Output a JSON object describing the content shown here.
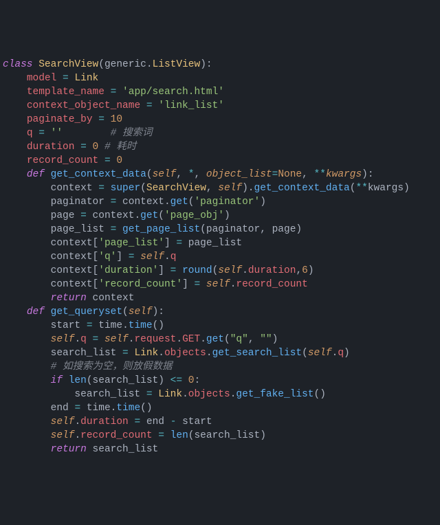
{
  "code": {
    "lines": [
      {
        "indent": 0,
        "tokens": [
          {
            "t": "class ",
            "c": "kw"
          },
          {
            "t": "SearchView",
            "c": "cls"
          },
          {
            "t": "(",
            "c": "pun"
          },
          {
            "t": "generic",
            "c": "plain"
          },
          {
            "t": ".",
            "c": "pun"
          },
          {
            "t": "ListView",
            "c": "cls"
          },
          {
            "t": "):",
            "c": "pun"
          }
        ]
      },
      {
        "indent": 1,
        "tokens": [
          {
            "t": "model ",
            "c": "attr"
          },
          {
            "t": "= ",
            "c": "op"
          },
          {
            "t": "Link",
            "c": "cls"
          }
        ]
      },
      {
        "indent": 1,
        "tokens": [
          {
            "t": "template_name ",
            "c": "attr"
          },
          {
            "t": "= ",
            "c": "op"
          },
          {
            "t": "'app/search.html'",
            "c": "str"
          }
        ]
      },
      {
        "indent": 1,
        "tokens": [
          {
            "t": "context_object_name ",
            "c": "attr"
          },
          {
            "t": "= ",
            "c": "op"
          },
          {
            "t": "'link_list'",
            "c": "str"
          }
        ]
      },
      {
        "indent": 1,
        "tokens": [
          {
            "t": "paginate_by ",
            "c": "attr"
          },
          {
            "t": "= ",
            "c": "op"
          },
          {
            "t": "10",
            "c": "num"
          }
        ]
      },
      {
        "indent": 1,
        "tokens": [
          {
            "t": "q ",
            "c": "attr"
          },
          {
            "t": "= ",
            "c": "op"
          },
          {
            "t": "''",
            "c": "str"
          },
          {
            "t": "        ",
            "c": "plain"
          },
          {
            "t": "# 搜索词",
            "c": "cmt"
          }
        ]
      },
      {
        "indent": 1,
        "tokens": [
          {
            "t": "duration ",
            "c": "attr"
          },
          {
            "t": "= ",
            "c": "op"
          },
          {
            "t": "0 ",
            "c": "num"
          },
          {
            "t": "# 耗时",
            "c": "cmt"
          }
        ]
      },
      {
        "indent": 1,
        "tokens": [
          {
            "t": "record_count ",
            "c": "attr"
          },
          {
            "t": "= ",
            "c": "op"
          },
          {
            "t": "0",
            "c": "num"
          }
        ]
      },
      {
        "indent": 1,
        "tokens": [
          {
            "t": "def ",
            "c": "kw"
          },
          {
            "t": "get_context_data",
            "c": "fn"
          },
          {
            "t": "(",
            "c": "pun"
          },
          {
            "t": "self",
            "c": "param"
          },
          {
            "t": ", ",
            "c": "pun"
          },
          {
            "t": "*",
            "c": "op"
          },
          {
            "t": ", ",
            "c": "pun"
          },
          {
            "t": "object_list",
            "c": "param"
          },
          {
            "t": "=",
            "c": "op"
          },
          {
            "t": "None",
            "c": "none"
          },
          {
            "t": ", ",
            "c": "pun"
          },
          {
            "t": "**",
            "c": "op"
          },
          {
            "t": "kwargs",
            "c": "param"
          },
          {
            "t": "):",
            "c": "pun"
          }
        ]
      },
      {
        "indent": 2,
        "tokens": [
          {
            "t": "context ",
            "c": "plain"
          },
          {
            "t": "= ",
            "c": "op"
          },
          {
            "t": "super",
            "c": "fn"
          },
          {
            "t": "(",
            "c": "pun"
          },
          {
            "t": "SearchView",
            "c": "cls"
          },
          {
            "t": ", ",
            "c": "pun"
          },
          {
            "t": "self",
            "c": "param"
          },
          {
            "t": ").",
            "c": "pun"
          },
          {
            "t": "get_context_data",
            "c": "fn"
          },
          {
            "t": "(",
            "c": "pun"
          },
          {
            "t": "**",
            "c": "op"
          },
          {
            "t": "kwargs",
            "c": "plain"
          },
          {
            "t": ")",
            "c": "pun"
          }
        ]
      },
      {
        "indent": 2,
        "tokens": [
          {
            "t": "paginator ",
            "c": "plain"
          },
          {
            "t": "= ",
            "c": "op"
          },
          {
            "t": "context",
            "c": "plain"
          },
          {
            "t": ".",
            "c": "pun"
          },
          {
            "t": "get",
            "c": "fn"
          },
          {
            "t": "(",
            "c": "pun"
          },
          {
            "t": "'paginator'",
            "c": "str"
          },
          {
            "t": ")",
            "c": "pun"
          }
        ]
      },
      {
        "indent": 2,
        "tokens": [
          {
            "t": "page ",
            "c": "plain"
          },
          {
            "t": "= ",
            "c": "op"
          },
          {
            "t": "context",
            "c": "plain"
          },
          {
            "t": ".",
            "c": "pun"
          },
          {
            "t": "get",
            "c": "fn"
          },
          {
            "t": "(",
            "c": "pun"
          },
          {
            "t": "'page_obj'",
            "c": "str"
          },
          {
            "t": ")",
            "c": "pun"
          }
        ]
      },
      {
        "indent": 2,
        "tokens": [
          {
            "t": "page_list ",
            "c": "plain"
          },
          {
            "t": "= ",
            "c": "op"
          },
          {
            "t": "get_page_list",
            "c": "fn"
          },
          {
            "t": "(",
            "c": "pun"
          },
          {
            "t": "paginator",
            "c": "plain"
          },
          {
            "t": ", ",
            "c": "pun"
          },
          {
            "t": "page",
            "c": "plain"
          },
          {
            "t": ")",
            "c": "pun"
          }
        ]
      },
      {
        "indent": 2,
        "tokens": [
          {
            "t": "context",
            "c": "plain"
          },
          {
            "t": "[",
            "c": "pun"
          },
          {
            "t": "'page_list'",
            "c": "str"
          },
          {
            "t": "] ",
            "c": "pun"
          },
          {
            "t": "= ",
            "c": "op"
          },
          {
            "t": "page_list",
            "c": "plain"
          }
        ]
      },
      {
        "indent": 2,
        "tokens": [
          {
            "t": "context",
            "c": "plain"
          },
          {
            "t": "[",
            "c": "pun"
          },
          {
            "t": "'q'",
            "c": "str"
          },
          {
            "t": "] ",
            "c": "pun"
          },
          {
            "t": "= ",
            "c": "op"
          },
          {
            "t": "self",
            "c": "param"
          },
          {
            "t": ".",
            "c": "pun"
          },
          {
            "t": "q",
            "c": "attr"
          }
        ]
      },
      {
        "indent": 2,
        "tokens": [
          {
            "t": "context",
            "c": "plain"
          },
          {
            "t": "[",
            "c": "pun"
          },
          {
            "t": "'duration'",
            "c": "str"
          },
          {
            "t": "] ",
            "c": "pun"
          },
          {
            "t": "= ",
            "c": "op"
          },
          {
            "t": "round",
            "c": "fn"
          },
          {
            "t": "(",
            "c": "pun"
          },
          {
            "t": "self",
            "c": "param"
          },
          {
            "t": ".",
            "c": "pun"
          },
          {
            "t": "duration",
            "c": "attr"
          },
          {
            "t": ",",
            "c": "pun"
          },
          {
            "t": "6",
            "c": "num"
          },
          {
            "t": ")",
            "c": "pun"
          }
        ]
      },
      {
        "indent": 2,
        "tokens": [
          {
            "t": "context",
            "c": "plain"
          },
          {
            "t": "[",
            "c": "pun"
          },
          {
            "t": "'record_count'",
            "c": "str"
          },
          {
            "t": "] ",
            "c": "pun"
          },
          {
            "t": "= ",
            "c": "op"
          },
          {
            "t": "self",
            "c": "param"
          },
          {
            "t": ".",
            "c": "pun"
          },
          {
            "t": "record_count",
            "c": "attr"
          }
        ]
      },
      {
        "indent": 2,
        "tokens": [
          {
            "t": "return ",
            "c": "kw"
          },
          {
            "t": "context",
            "c": "plain"
          }
        ]
      },
      {
        "indent": 1,
        "tokens": [
          {
            "t": "def ",
            "c": "kw"
          },
          {
            "t": "get_queryset",
            "c": "fn"
          },
          {
            "t": "(",
            "c": "pun"
          },
          {
            "t": "self",
            "c": "param"
          },
          {
            "t": "):",
            "c": "pun"
          }
        ]
      },
      {
        "indent": 2,
        "tokens": [
          {
            "t": "start ",
            "c": "plain"
          },
          {
            "t": "= ",
            "c": "op"
          },
          {
            "t": "time",
            "c": "plain"
          },
          {
            "t": ".",
            "c": "pun"
          },
          {
            "t": "time",
            "c": "fn"
          },
          {
            "t": "()",
            "c": "pun"
          }
        ]
      },
      {
        "indent": 2,
        "tokens": [
          {
            "t": "self",
            "c": "param"
          },
          {
            "t": ".",
            "c": "pun"
          },
          {
            "t": "q ",
            "c": "attr"
          },
          {
            "t": "= ",
            "c": "op"
          },
          {
            "t": "self",
            "c": "param"
          },
          {
            "t": ".",
            "c": "pun"
          },
          {
            "t": "request",
            "c": "attr"
          },
          {
            "t": ".",
            "c": "pun"
          },
          {
            "t": "GET",
            "c": "attr"
          },
          {
            "t": ".",
            "c": "pun"
          },
          {
            "t": "get",
            "c": "fn"
          },
          {
            "t": "(",
            "c": "pun"
          },
          {
            "t": "\"q\"",
            "c": "str"
          },
          {
            "t": ", ",
            "c": "pun"
          },
          {
            "t": "\"\"",
            "c": "str"
          },
          {
            "t": ")",
            "c": "pun"
          }
        ]
      },
      {
        "indent": 2,
        "tokens": [
          {
            "t": "search_list ",
            "c": "plain"
          },
          {
            "t": "= ",
            "c": "op"
          },
          {
            "t": "Link",
            "c": "cls"
          },
          {
            "t": ".",
            "c": "pun"
          },
          {
            "t": "objects",
            "c": "attr"
          },
          {
            "t": ".",
            "c": "pun"
          },
          {
            "t": "get_search_list",
            "c": "fn"
          },
          {
            "t": "(",
            "c": "pun"
          },
          {
            "t": "self",
            "c": "param"
          },
          {
            "t": ".",
            "c": "pun"
          },
          {
            "t": "q",
            "c": "attr"
          },
          {
            "t": ")",
            "c": "pun"
          }
        ]
      },
      {
        "indent": 2,
        "tokens": [
          {
            "t": "# 如搜索为空，则放假数据",
            "c": "cmt"
          }
        ]
      },
      {
        "indent": 2,
        "tokens": [
          {
            "t": "if ",
            "c": "kw"
          },
          {
            "t": "len",
            "c": "fn"
          },
          {
            "t": "(",
            "c": "pun"
          },
          {
            "t": "search_list",
            "c": "plain"
          },
          {
            "t": ") ",
            "c": "pun"
          },
          {
            "t": "<= ",
            "c": "op"
          },
          {
            "t": "0",
            "c": "num"
          },
          {
            "t": ":",
            "c": "pun"
          }
        ]
      },
      {
        "indent": 3,
        "tokens": [
          {
            "t": "search_list ",
            "c": "plain"
          },
          {
            "t": "= ",
            "c": "op"
          },
          {
            "t": "Link",
            "c": "cls"
          },
          {
            "t": ".",
            "c": "pun"
          },
          {
            "t": "objects",
            "c": "attr"
          },
          {
            "t": ".",
            "c": "pun"
          },
          {
            "t": "get_fake_list",
            "c": "fn"
          },
          {
            "t": "()",
            "c": "pun"
          }
        ]
      },
      {
        "indent": 2,
        "tokens": [
          {
            "t": "end ",
            "c": "plain"
          },
          {
            "t": "= ",
            "c": "op"
          },
          {
            "t": "time",
            "c": "plain"
          },
          {
            "t": ".",
            "c": "pun"
          },
          {
            "t": "time",
            "c": "fn"
          },
          {
            "t": "()",
            "c": "pun"
          }
        ]
      },
      {
        "indent": 2,
        "tokens": [
          {
            "t": "self",
            "c": "param"
          },
          {
            "t": ".",
            "c": "pun"
          },
          {
            "t": "duration ",
            "c": "attr"
          },
          {
            "t": "= ",
            "c": "op"
          },
          {
            "t": "end ",
            "c": "plain"
          },
          {
            "t": "- ",
            "c": "op"
          },
          {
            "t": "start",
            "c": "plain"
          }
        ]
      },
      {
        "indent": 2,
        "tokens": [
          {
            "t": "self",
            "c": "param"
          },
          {
            "t": ".",
            "c": "pun"
          },
          {
            "t": "record_count ",
            "c": "attr"
          },
          {
            "t": "= ",
            "c": "op"
          },
          {
            "t": "len",
            "c": "fn"
          },
          {
            "t": "(",
            "c": "pun"
          },
          {
            "t": "search_list",
            "c": "plain"
          },
          {
            "t": ")",
            "c": "pun"
          }
        ]
      },
      {
        "indent": 2,
        "tokens": [
          {
            "t": "return ",
            "c": "kw"
          },
          {
            "t": "search_list",
            "c": "plain"
          }
        ]
      }
    ],
    "indent_unit": "    "
  }
}
